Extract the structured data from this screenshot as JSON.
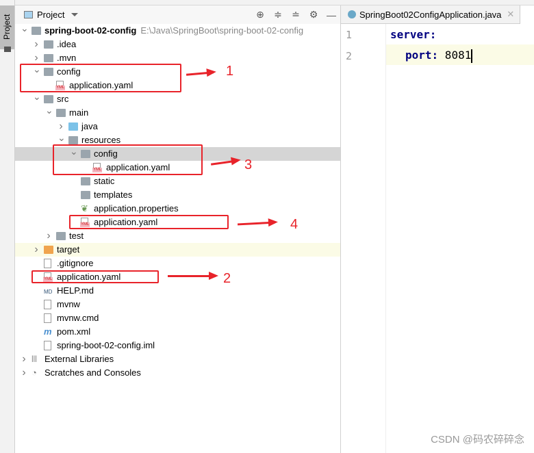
{
  "sidebar": {
    "tab_label": "Project"
  },
  "project_panel": {
    "title": "Project",
    "tools": [
      "locate-icon",
      "expand-all-icon",
      "collapse-all-icon",
      "gear-icon",
      "minimize-icon"
    ]
  },
  "tree": [
    {
      "label": "spring-boot-02-config",
      "path": "E:\\Java\\SpringBoot\\spring-boot-02-config",
      "level": 0,
      "type": "module",
      "expanded": true,
      "bold": true
    },
    {
      "label": ".idea",
      "level": 1,
      "type": "folder",
      "expanded": false
    },
    {
      "label": ".mvn",
      "level": 1,
      "type": "folder",
      "expanded": false
    },
    {
      "label": "config",
      "level": 1,
      "type": "folder",
      "expanded": true
    },
    {
      "label": "application.yaml",
      "level": 2,
      "type": "yaml"
    },
    {
      "label": "src",
      "level": 1,
      "type": "folder",
      "expanded": true
    },
    {
      "label": "main",
      "level": 2,
      "type": "folder",
      "expanded": true
    },
    {
      "label": "java",
      "level": 3,
      "type": "folder-blue",
      "expanded": false
    },
    {
      "label": "resources",
      "level": 3,
      "type": "folder",
      "expanded": true
    },
    {
      "label": "config",
      "level": 4,
      "type": "folder",
      "expanded": true,
      "selected": true
    },
    {
      "label": "application.yaml",
      "level": 5,
      "type": "yaml"
    },
    {
      "label": "static",
      "level": 4,
      "type": "folder"
    },
    {
      "label": "templates",
      "level": 4,
      "type": "folder"
    },
    {
      "label": "application.properties",
      "level": 4,
      "type": "properties"
    },
    {
      "label": "application.yaml",
      "level": 4,
      "type": "yaml"
    },
    {
      "label": "test",
      "level": 2,
      "type": "folder",
      "expanded": false
    },
    {
      "label": "target",
      "level": 1,
      "type": "folder-orange",
      "expanded": false,
      "highlighted": true
    },
    {
      "label": ".gitignore",
      "level": 1,
      "type": "file"
    },
    {
      "label": "application.yaml",
      "level": 1,
      "type": "yaml"
    },
    {
      "label": "HELP.md",
      "level": 1,
      "type": "md"
    },
    {
      "label": "mvnw",
      "level": 1,
      "type": "file"
    },
    {
      "label": "mvnw.cmd",
      "level": 1,
      "type": "file"
    },
    {
      "label": "pom.xml",
      "level": 1,
      "type": "maven"
    },
    {
      "label": "spring-boot-02-config.iml",
      "level": 1,
      "type": "file"
    },
    {
      "label": "External Libraries",
      "level": 0,
      "type": "library",
      "expanded": false
    },
    {
      "label": "Scratches and Consoles",
      "level": 0,
      "type": "scratch",
      "expanded": false
    }
  ],
  "editor": {
    "tab_label": "SpringBoot02ConfigApplication.java",
    "line_numbers": [
      "1",
      "2"
    ],
    "lines": [
      {
        "key": "server:",
        "value": ""
      },
      {
        "key": "port:",
        "value": " 8081"
      }
    ]
  },
  "annotations": [
    "1",
    "2",
    "3",
    "4"
  ],
  "watermark": "CSDN @码农碎碎念",
  "colors": {
    "annotation": "#e8232a",
    "selection": "#d5d5d5",
    "highlight": "#fbfbe6",
    "yaml_key": "#000080"
  }
}
